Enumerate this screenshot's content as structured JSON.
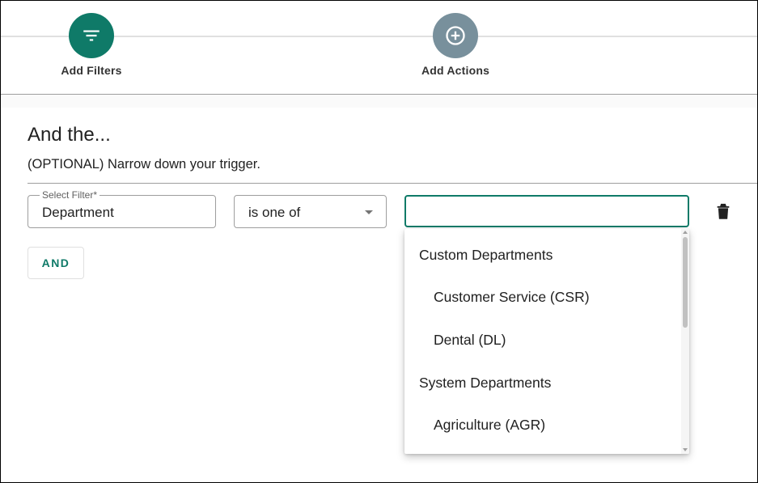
{
  "colors": {
    "accent": "#0f7a68",
    "inactive_step": "#78909c"
  },
  "stepper": {
    "steps": [
      {
        "label": "Add Filters",
        "icon": "filter-list-icon",
        "active": true
      },
      {
        "label": "Add Actions",
        "icon": "add-circle-icon",
        "active": false
      }
    ]
  },
  "section": {
    "title": "And the...",
    "subtitle": "(OPTIONAL) Narrow down your trigger."
  },
  "filter_row": {
    "select_filter_label": "Select Filter*",
    "select_filter_value": "Department",
    "operator_value": "is one of",
    "value_input": "",
    "delete_icon": "trash-icon"
  },
  "and_button_label": "AND",
  "dropdown": {
    "groups": [
      {
        "label": "Custom Departments",
        "options": [
          "Customer Service (CSR)",
          "Dental (DL)"
        ]
      },
      {
        "label": "System Departments",
        "options": [
          "Agriculture (AGR)"
        ]
      }
    ]
  }
}
